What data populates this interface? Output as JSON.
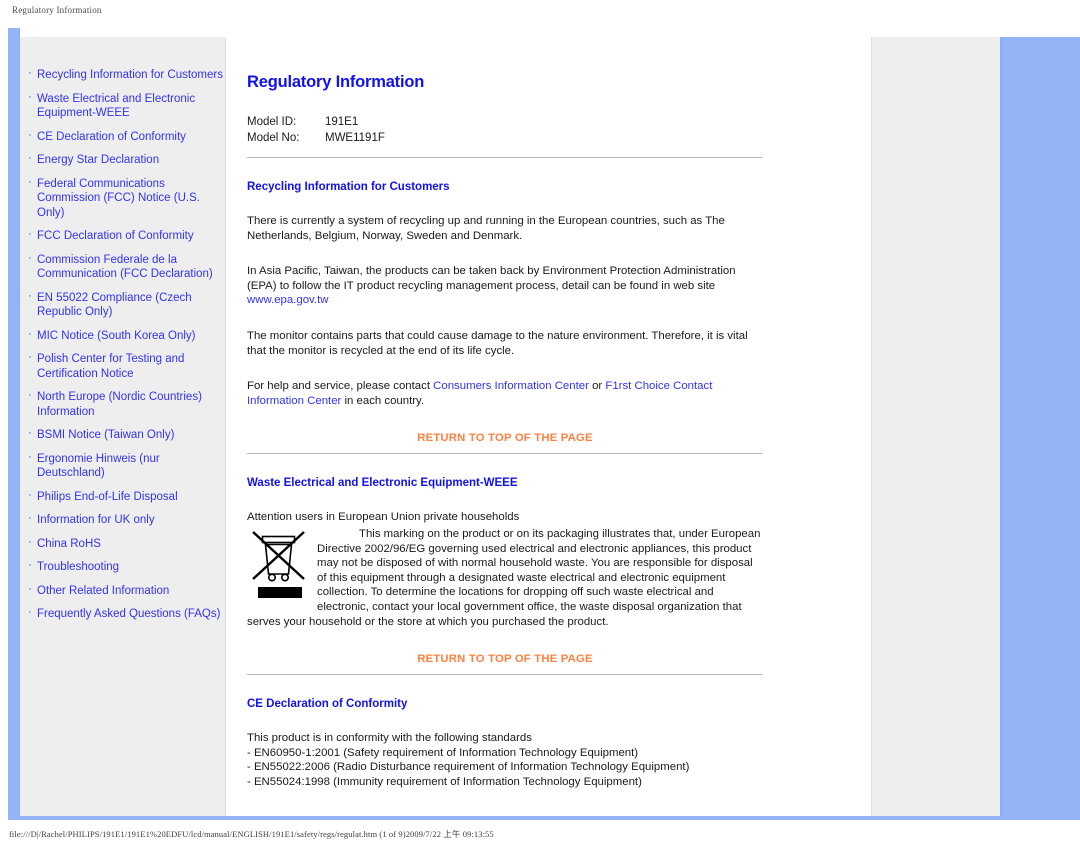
{
  "browser": {
    "page_header_title": "Regulatory Information",
    "status_bar": "file:///D|/Rachel/PHILIPS/191E1/191E1%20EDFU/lcd/manual/ENGLISH/191E1/safety/regs/regulat.htm (1 of 9)2009/7/22 上午 09:13:55"
  },
  "colors": {
    "link_blue": "#3333ee",
    "heading_blue": "#1111ee",
    "return_orange": "#ff8040",
    "rail_blue": "#93b4f7",
    "band_grey": "#eeeeee"
  },
  "sidebar": {
    "items": [
      {
        "label": "Recycling Information for Customers"
      },
      {
        "label": "Waste Electrical and Electronic Equipment-WEEE"
      },
      {
        "label": "CE Declaration of Conformity"
      },
      {
        "label": "Energy Star Declaration"
      },
      {
        "label": "Federal Communications Commission (FCC) Notice (U.S. Only)"
      },
      {
        "label": "FCC Declaration of Conformity"
      },
      {
        "label": "Commission Federale de la Communication (FCC Declaration)"
      },
      {
        "label": "EN 55022 Compliance (Czech Republic Only)"
      },
      {
        "label": "MIC Notice (South Korea Only)"
      },
      {
        "label": "Polish Center for Testing and Certification Notice"
      },
      {
        "label": "North Europe (Nordic Countries) Information"
      },
      {
        "label": "BSMI Notice (Taiwan Only)"
      },
      {
        "label": "Ergonomie Hinweis (nur Deutschland)"
      },
      {
        "label": "Philips End-of-Life Disposal"
      },
      {
        "label": "Information for UK only"
      },
      {
        "label": "China RoHS"
      },
      {
        "label": "Troubleshooting"
      },
      {
        "label": "Other Related Information"
      },
      {
        "label": "Frequently Asked Questions (FAQs)"
      }
    ]
  },
  "main": {
    "title": "Regulatory Information",
    "model": {
      "id_label": "Model ID:",
      "id_value": "191E1",
      "no_label": "Model No:",
      "no_value": "MWE1191F"
    },
    "return_to_top_label": "RETURN TO TOP OF THE PAGE",
    "sections": [
      {
        "heading": "Recycling Information for Customers",
        "p1": "There is currently a system of recycling up and running in the European countries, such as The Netherlands, Belgium, Norway, Sweden and Denmark.",
        "p2_before": "In Asia Pacific, Taiwan, the products can be taken back by Environment Protection Administration (EPA) to follow the IT product recycling management process, detail can be found in web site ",
        "p2_link": "www.epa.gov.tw",
        "p3": "The monitor contains parts that could cause damage to the nature environment. Therefore, it is vital that the monitor is recycled at the end of its life cycle.",
        "p4_before": "For help and service, please contact ",
        "p4_link1": "Consumers Information Center",
        "p4_middle": " or ",
        "p4_link2": "F1rst Choice Contact Information Center",
        "p4_after": " in each country."
      },
      {
        "heading": "Waste Electrical and Electronic Equipment-WEEE",
        "p1": "Attention users in European Union private households",
        "icon_name": "crossed-out-wheeled-bin-icon",
        "p2": "This marking on the product or on its packaging illustrates that, under European Directive 2002/96/EG governing used electrical and electronic appliances, this product may not be disposed of with normal household waste. You are responsible for disposal of this equipment through a designated waste electrical and electronic equipment collection. To determine the locations for dropping off such waste electrical and electronic, contact your local government office, the waste disposal organization that serves your household or the store at which you purchased the product."
      },
      {
        "heading": "CE Declaration of Conformity",
        "p1": "This product is in conformity with the following standards",
        "standards": [
          "- EN60950-1:2001 (Safety requirement of Information Technology Equipment)",
          "- EN55022:2006 (Radio Disturbance requirement of Information Technology Equipment)",
          "- EN55024:1998 (Immunity requirement of Information Technology Equipment)"
        ]
      }
    ]
  }
}
